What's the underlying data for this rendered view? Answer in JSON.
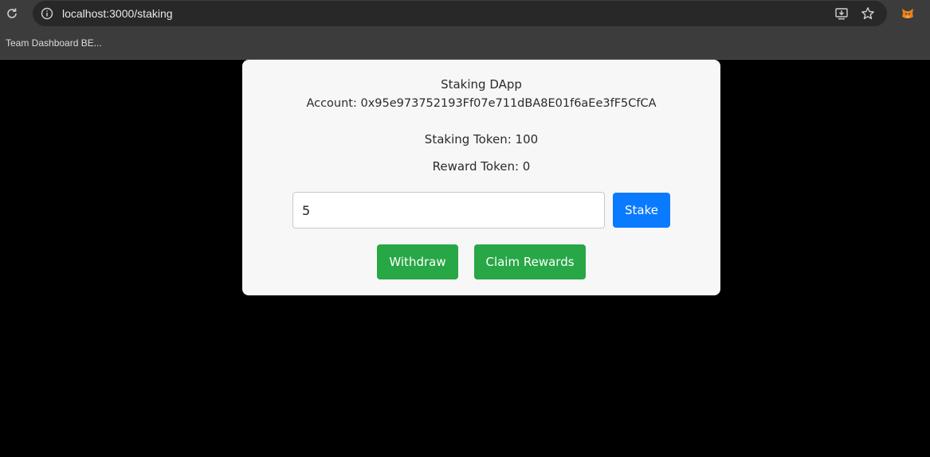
{
  "browser": {
    "url": "localhost:3000/staking",
    "bookmarks": [
      "Team Dashboard BE..."
    ],
    "icons": [
      "reload-icon",
      "site-info-icon",
      "install-app-icon",
      "bookmark-star-icon",
      "metamask-extension-icon"
    ]
  },
  "app": {
    "title": "Staking DApp",
    "account_line": "Account: 0x95e973752193Ff07e711dBA8E01f6aEe3fF5CfCA",
    "staking_token_line": "Staking Token: 100",
    "reward_token_line": "Reward Token: 0",
    "stake_amount_value": "5",
    "stake_button": "Stake",
    "withdraw_button": "Withdraw",
    "claim_button": "Claim Rewards"
  },
  "colors": {
    "background": "#000000",
    "card": "#f7f7f7",
    "primary_button": "#0a7bff",
    "success_button": "#27a745"
  }
}
